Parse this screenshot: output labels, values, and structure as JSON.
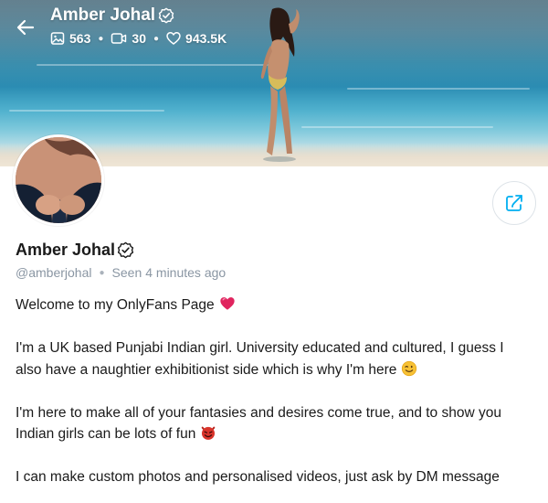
{
  "cover": {
    "name": "Amber Johal",
    "stats": {
      "photos": "563",
      "videos": "30",
      "likes": "943.5K"
    }
  },
  "profile": {
    "name": "Amber Johal",
    "handle": "@amberjohal",
    "seen_label": "Seen",
    "seen_time": "4 minutes ago"
  },
  "bio": {
    "line1": "Welcome to my OnlyFans Page",
    "line2": "I'm a UK based Punjabi Indian girl. University educated and cultured, I guess I also have a naughtier exhibitionist side which is why I'm here",
    "line3": "I'm here to make all of your fantasies and desires come true, and to show you Indian girls can be lots of fun",
    "line4": "I can make custom photos and personalised videos, just ask by DM message"
  },
  "icons": {
    "back": "arrow-left-icon",
    "verified": "verified-badge-icon",
    "photos": "image-icon",
    "videos": "video-icon",
    "likes": "heart-icon",
    "share": "share-icon",
    "heart_emoji": "red-heart-emoji",
    "wink_emoji": "winking-face-emoji",
    "devil_emoji": "smiling-devil-emoji"
  },
  "colors": {
    "accent": "#00aff0",
    "muted_text": "#8a96a3",
    "text": "#1a1a1a",
    "heart": "#e0245e",
    "devil": "#d9342b",
    "emoji_yellow": "#f7c134"
  }
}
